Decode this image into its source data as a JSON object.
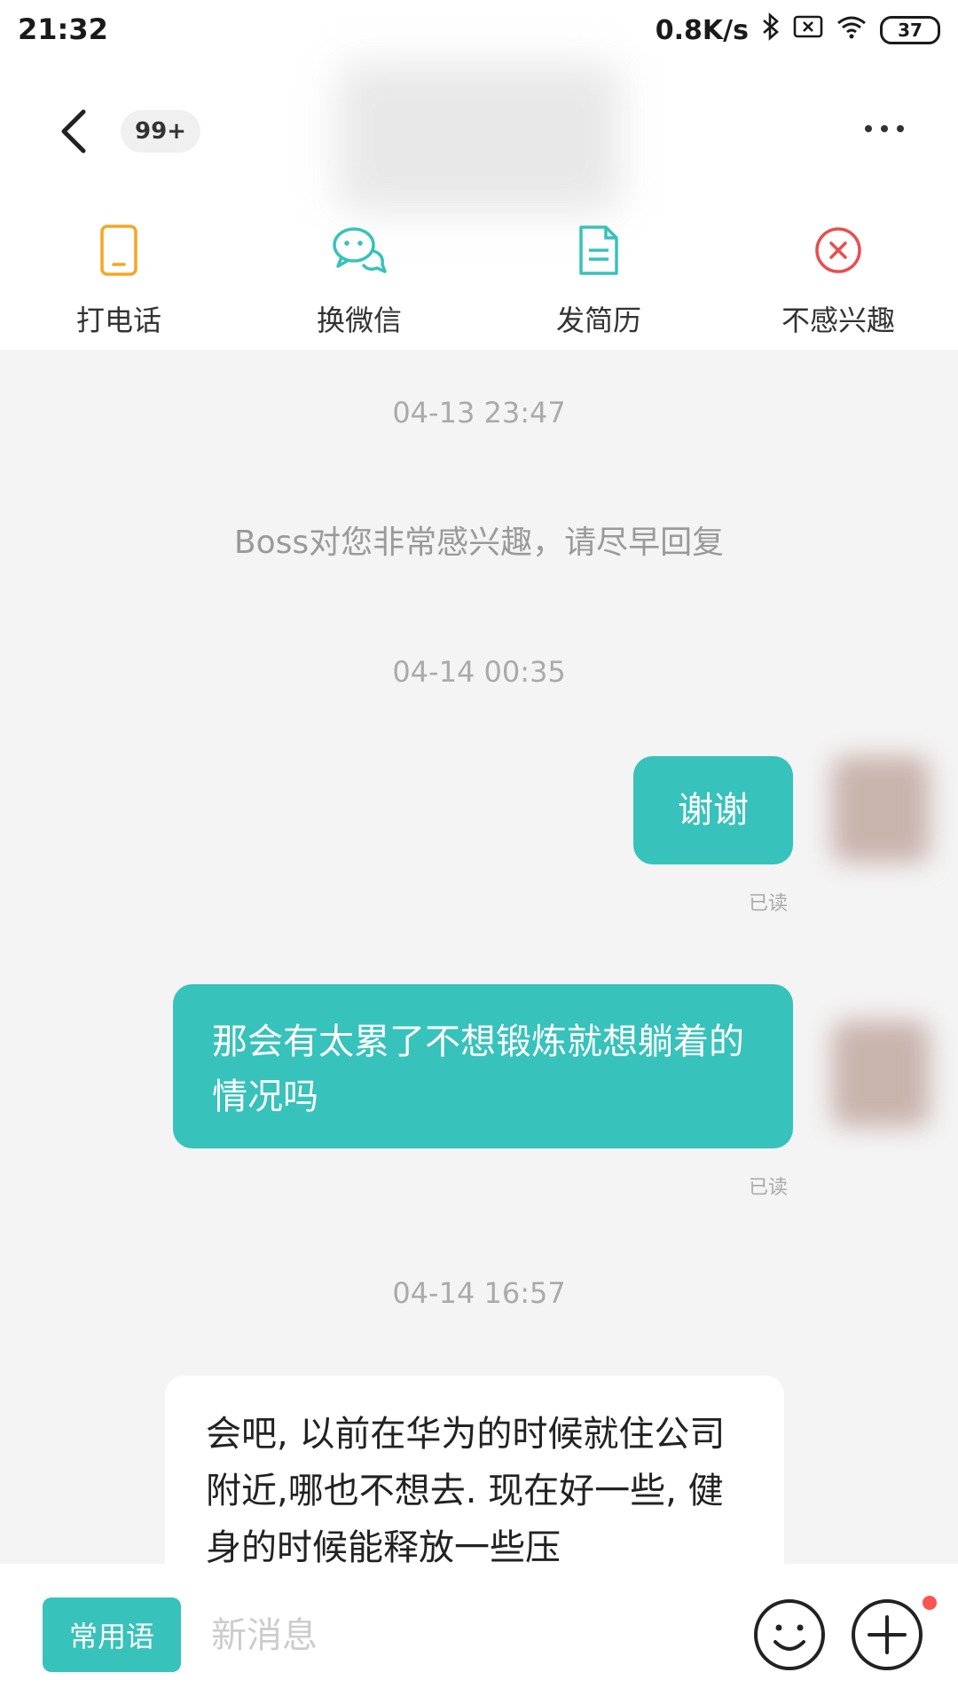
{
  "status_bar": {
    "time": "21:32",
    "network_speed": "0.8K/s",
    "battery": "37",
    "icons": [
      "bluetooth-icon",
      "sim-no-signal-icon",
      "wifi-icon",
      "battery-icon"
    ]
  },
  "header": {
    "unread_badge": "99+",
    "actions": [
      {
        "label": "打电话",
        "icon": "phone-icon",
        "color": "#f5a623"
      },
      {
        "label": "换微信",
        "icon": "wechat-icon",
        "color": "#37c2bb"
      },
      {
        "label": "发简历",
        "icon": "resume-document-icon",
        "color": "#37c2bb"
      },
      {
        "label": "不感兴趣",
        "icon": "not-interested-icon",
        "color": "#e94e4e"
      }
    ]
  },
  "chat": {
    "messages": [
      {
        "type": "timestamp",
        "text": "04-13 23:47"
      },
      {
        "type": "system",
        "text": "Boss对您非常感兴趣，请尽早回复"
      },
      {
        "type": "timestamp",
        "text": "04-14 00:35"
      },
      {
        "type": "mine",
        "text": "谢谢",
        "status": "已读"
      },
      {
        "type": "mine",
        "text": "那会有太累了不想锻炼就想躺着的情况吗",
        "status": "已读"
      },
      {
        "type": "timestamp",
        "text": "04-14 16:57"
      },
      {
        "type": "other",
        "text": "会吧, 以前在华为的时候就住公司附近,哪也不想去. 现在好一些, 健身的时候能释放一些压"
      }
    ]
  },
  "input_bar": {
    "phrase_button": "常用语",
    "placeholder": "新消息"
  },
  "colors": {
    "accent": "#37c2bb",
    "phone": "#f5a623",
    "danger": "#e94e4e",
    "background": "#f4f4f4"
  }
}
